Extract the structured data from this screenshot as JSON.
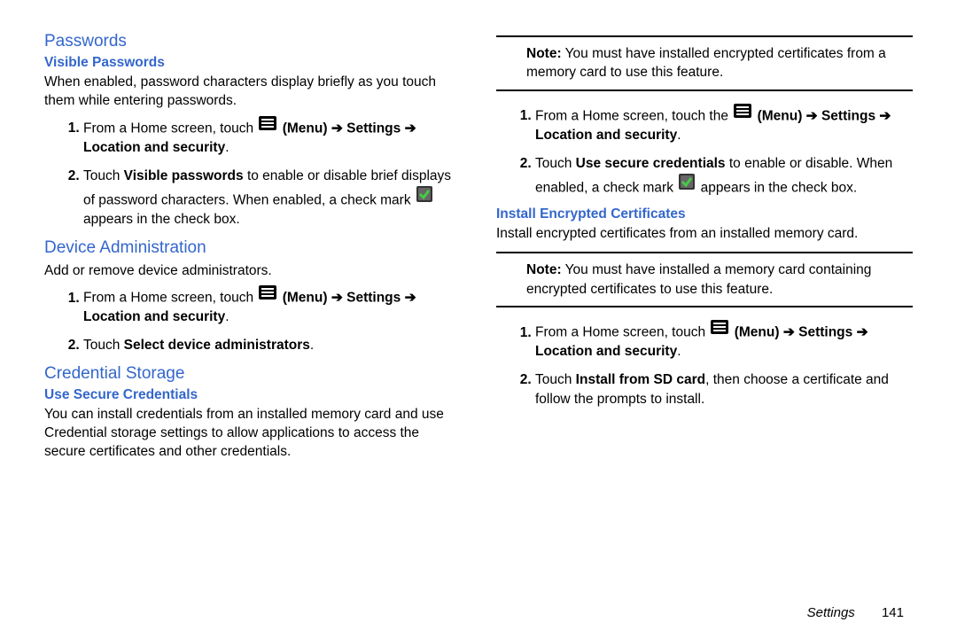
{
  "left": {
    "passwords": {
      "title": "Passwords",
      "visible": {
        "title": "Visible Passwords",
        "desc": "When enabled, password characters display briefly as you touch them while entering passwords.",
        "step1a": "From a Home screen, touch ",
        "step1b": " (Menu) ➔ Settings ➔ Location and security",
        "step1c": ".",
        "step2a": "Touch ",
        "step2b": "Visible passwords",
        "step2c": " to enable or disable brief displays of password characters. When enabled, a check mark ",
        "step2d": " appears in the check box."
      }
    },
    "deviceAdmin": {
      "title": "Device Administration",
      "desc": "Add or remove device administrators.",
      "step1a": "From a Home screen, touch ",
      "step1b": " (Menu) ➔ Settings ➔ Location and security",
      "step1c": ".",
      "step2a": "Touch ",
      "step2b": "Select device administrators",
      "step2c": "."
    },
    "credStorage": {
      "title": "Credential Storage",
      "useSecure": {
        "title": "Use Secure Credentials",
        "desc": "You can install credentials from an installed memory card and use Credential storage settings to allow applications to access the secure certificates and other credentials."
      }
    }
  },
  "right": {
    "note1a": "Note:",
    "note1b": " You must have installed encrypted certificates from a memory card to use this feature.",
    "step1a": "From a Home screen, touch the ",
    "step1b": " (Menu) ➔ Settings ➔ Location and security",
    "step1c": ".",
    "step2a": "Touch ",
    "step2b": "Use secure credentials",
    "step2c": " to enable or disable. When enabled, a check mark ",
    "step2d": " appears in the check box.",
    "install": {
      "title": "Install Encrypted Certificates",
      "desc": "Install encrypted certificates from an installed memory card.",
      "note1a": "Note:",
      "note1b": " You must have installed a memory card containing encrypted certificates to use this feature.",
      "step1a": "From a Home screen, touch ",
      "step1b": " (Menu) ➔ Settings ➔ Location and security",
      "step1c": ".",
      "step2a": "Touch ",
      "step2b": "Install from SD card",
      "step2c": ", then choose a certificate and follow the prompts to install."
    }
  },
  "footer": {
    "section": "Settings",
    "page": "141"
  }
}
